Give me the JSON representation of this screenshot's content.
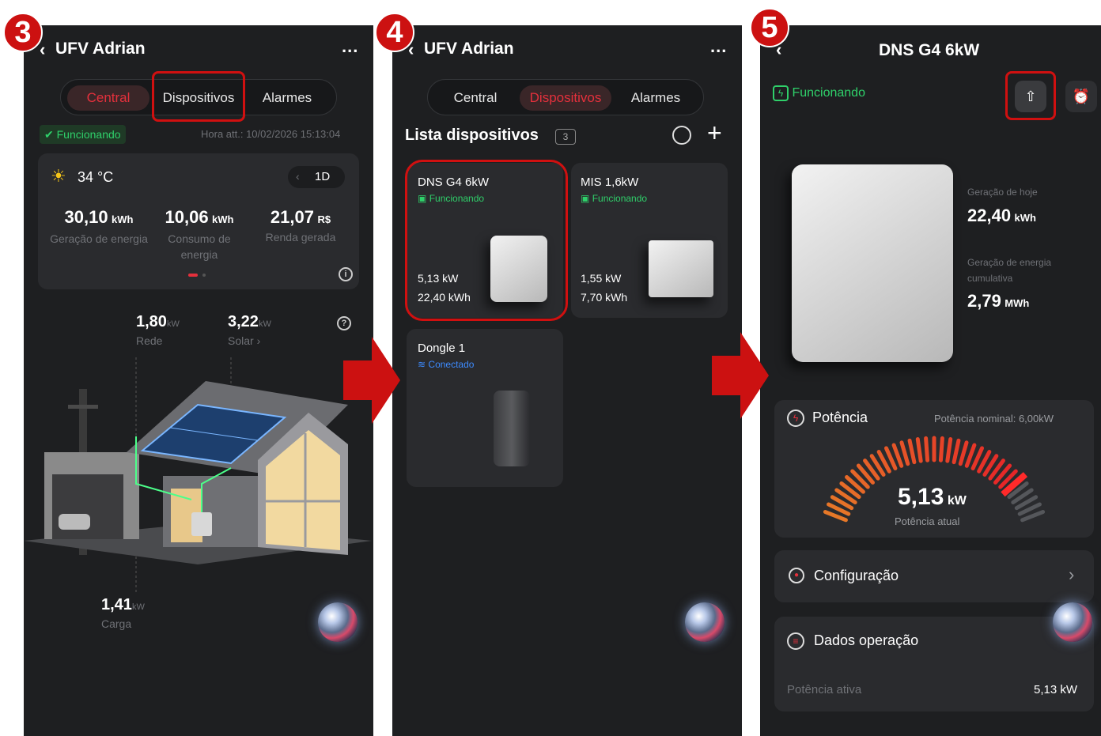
{
  "steps": [
    "3",
    "4",
    "5"
  ],
  "p3": {
    "title": "UFV Adrian",
    "more": "...",
    "tabs": [
      "Central",
      "Dispositivos",
      "Alarmes"
    ],
    "status": "Funcionando",
    "updated": "Hora att.: 10/02/2026 15:13:04",
    "temperature": "34 °C",
    "period": "1D",
    "metrics": [
      {
        "value": "30,10",
        "unit": "kWh",
        "label": "Geração de energia"
      },
      {
        "value": "10,06",
        "unit": "kWh",
        "label": "Consumo de energia"
      },
      {
        "value": "21,07",
        "unit": "R$",
        "label": "Renda gerada"
      }
    ],
    "flows": {
      "grid": {
        "value": "1,80",
        "unit": "kW",
        "label": "Rede"
      },
      "solar": {
        "value": "3,22",
        "unit": "kW",
        "label": "Solar ›"
      },
      "load": {
        "value": "1,41",
        "unit": "kW",
        "label": "Carga"
      }
    }
  },
  "p4": {
    "title": "UFV Adrian",
    "more": "...",
    "tabs": [
      "Central",
      "Dispositivos",
      "Alarmes"
    ],
    "list_title": "Lista dispositivos",
    "count": "3",
    "devices": [
      {
        "name": "DNS G4 6kW",
        "status": "Funcionando",
        "power": "5,13 kW",
        "energy": "22,40 kWh"
      },
      {
        "name": "MIS 1,6kW",
        "status": "Funcionando",
        "power": "1,55 kW",
        "energy": "7,70 kWh"
      },
      {
        "name": "Dongle 1",
        "status": "Conectado"
      }
    ]
  },
  "p5": {
    "title": "DNS G4 6kW",
    "status": "Funcionando",
    "today_label": "Geração de hoje",
    "today_value": "22,40",
    "today_unit": "kWh",
    "cumulative_label": "Geração de energia cumulativa",
    "cumulative_value": "2,79",
    "cumulative_unit": "MWh",
    "power_title": "Potência",
    "nominal": "Potência nominal: 6,00kW",
    "current_value": "5,13",
    "current_unit": "kW",
    "current_label": "Potência atual",
    "gauge_fraction": 0.855,
    "config": "Configuração",
    "ops": "Dados operação",
    "active_label": "Potência ativa",
    "active_value": "5,13 kW"
  },
  "colors": {
    "accent": "#e4303c",
    "ok": "#2fd06a",
    "link": "#3d8bff",
    "highlight": "#d01010"
  }
}
